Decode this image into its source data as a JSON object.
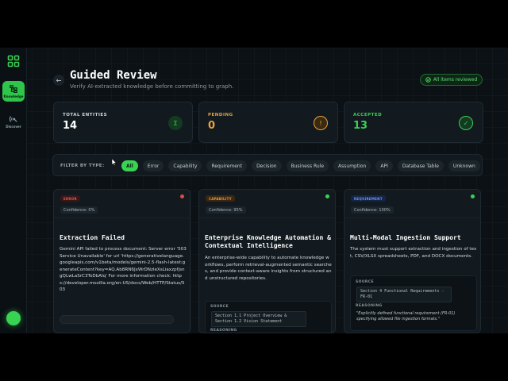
{
  "rail": {
    "logo_icon": "grid-icon",
    "items": [
      {
        "label": "Knowledge",
        "icon": "tree-icon"
      },
      {
        "label": "Discover",
        "icon": "radar-icon"
      }
    ]
  },
  "header": {
    "title": "Guided Review",
    "subtitle": "Verify AI-extracted knowledge before committing to graph.",
    "status_pill": "All items reviewed"
  },
  "stats": [
    {
      "label": "TOTAL ENTITIES",
      "value": "14",
      "color": "#e6ede9",
      "icon": "sigma-icon",
      "icon_glyph": "Σ"
    },
    {
      "label": "PENDING",
      "value": "0",
      "color": "#e8a23a",
      "icon": "alert-icon",
      "icon_glyph": "!"
    },
    {
      "label": "ACCEPTED",
      "value": "13",
      "color": "#39d353",
      "icon": "check-icon",
      "icon_glyph": "✓"
    }
  ],
  "filter": {
    "label": "FILTER BY TYPE:",
    "chips": [
      "All",
      "Error",
      "Capability",
      "Requirement",
      "Decision",
      "Business Rule",
      "Assumption",
      "API",
      "Database Table",
      "Unknown"
    ],
    "active": "All"
  },
  "cards": [
    {
      "tag": "ERROR",
      "confidence": "Confidence: 0%",
      "title": "Extraction Failed",
      "body": "Gemini API failed to process document: Server error '503 Service Unavailable' for url 'https://generativelanguage.googleapis.com/v1beta/models/gemini-2.5-flash-latest:generateContent?key=AQ.Ab8RN6JxWrDNzleXsLiaxzpfjsngQLwLaSrC3ToDbAIq' For more information check: https://developer.mozilla.org/en-US/docs/Web/HTTP/Status/503"
    },
    {
      "tag": "CAPABILITY",
      "confidence": "Confidence: 95%",
      "title": "Enterprise Knowledge Automation & Contextual Intelligence",
      "body": "An enterprise-wide capability to automate knowledge workflows, perform retrieval-augmented semantic searches, and provide context-aware insights from structured and unstructured repositories.",
      "source_label": "SOURCE",
      "source_ref": "Section 1.1 Project Overview & Section 1.2 Vision Statement",
      "reasoning_label": "REASONING"
    },
    {
      "tag": "REQUIREMENT",
      "confidence": "Confidence: 100%",
      "title": "Multi-Modal Ingestion Support",
      "body": "The system must support extraction and ingestion of text, CSV/XLSX spreadsheets, PDF, and DOCX documents.",
      "source_label": "SOURCE",
      "source_ref": "Section 4 Functional Requirements - FR-01",
      "reasoning_label": "REASONING",
      "reasoning": "\"Explicitly defined functional requirement (FR-01) specifying allowed file ingestion formats.\""
    }
  ],
  "colors": {
    "accent": "#39d353",
    "error": "#e04848",
    "capability": "#d9893a",
    "requirement": "#4a7bd9"
  }
}
